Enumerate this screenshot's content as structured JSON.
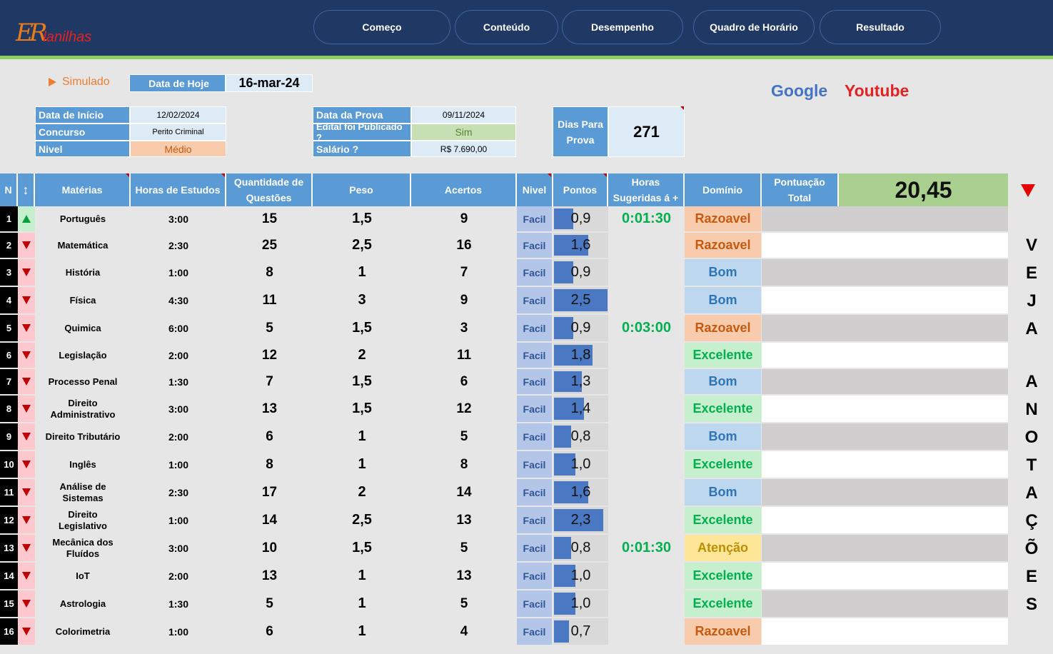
{
  "logo": {
    "mark": "ER",
    "text": "lanilhas"
  },
  "nav": [
    {
      "label": "Começo",
      "active": true
    },
    {
      "label": "Conteúdo",
      "active": false
    },
    {
      "label": "Desempenho",
      "active": false
    },
    {
      "label": "Quadro de Horário",
      "active": false
    },
    {
      "label": "Resultado",
      "active": false
    }
  ],
  "simulado": "Simulado",
  "data_hoje": {
    "label": "Data de Hoje",
    "value": "16-mar-24"
  },
  "info_left": [
    {
      "label": "Data  de Início",
      "value": "12/02/2024"
    },
    {
      "label": "Concurso",
      "value": "Perito Criminal"
    },
    {
      "label": "Nivel",
      "value": "Médio"
    }
  ],
  "info_mid": [
    {
      "label": "Data da Prova",
      "value": "09/11/2024"
    },
    {
      "label": "Edital foi Publicado ?",
      "value": "Sim"
    },
    {
      "label": "Salário ?",
      "value": "R$ 7.690,00"
    }
  ],
  "dias": {
    "label": "Dias Para Prova",
    "value": "271"
  },
  "links": {
    "google": "Google",
    "youtube": "Youtube"
  },
  "colors": {
    "header": "#1f3864",
    "accent_green": "#70ad47",
    "table_header": "#5b9bd5",
    "red": "#e52222",
    "blue_link": "#4472c4"
  },
  "table": {
    "headers": [
      "N",
      "↕",
      "Matérias",
      "Horas de Estudos",
      "Quantidade de Questões",
      "Peso",
      "Acertos",
      "Nivel",
      "Pontos",
      "Horas Sugeridas á +",
      "Domínio",
      "Pontuação Total"
    ],
    "total": "20,45",
    "max_pontos": 2.5,
    "rows": [
      {
        "n": "1",
        "trend": "up",
        "materia": "Português",
        "horas": "3:00",
        "qtd": "15",
        "peso": "1,5",
        "acertos": "9",
        "nivel": "Facil",
        "pontos": "0,9",
        "p": 0.9,
        "sugeridas": "0:01:30",
        "dominio": "Razoavel"
      },
      {
        "n": "2",
        "trend": "down",
        "materia": "Matemática",
        "horas": "2:30",
        "qtd": "25",
        "peso": "2,5",
        "acertos": "16",
        "nivel": "Facil",
        "pontos": "1,6",
        "p": 1.6,
        "sugeridas": "",
        "dominio": "Razoavel"
      },
      {
        "n": "3",
        "trend": "down",
        "materia": "História",
        "horas": "1:00",
        "qtd": "8",
        "peso": "1",
        "acertos": "7",
        "nivel": "Facil",
        "pontos": "0,9",
        "p": 0.9,
        "sugeridas": "",
        "dominio": "Bom"
      },
      {
        "n": "4",
        "trend": "down",
        "materia": "Física",
        "horas": "4:30",
        "qtd": "11",
        "peso": "3",
        "acertos": "9",
        "nivel": "Facil",
        "pontos": "2,5",
        "p": 2.5,
        "sugeridas": "",
        "dominio": "Bom"
      },
      {
        "n": "5",
        "trend": "down",
        "materia": "Quimica",
        "horas": "6:00",
        "qtd": "5",
        "peso": "1,5",
        "acertos": "3",
        "nivel": "Facil",
        "pontos": "0,9",
        "p": 0.9,
        "sugeridas": "0:03:00",
        "dominio": "Razoavel"
      },
      {
        "n": "6",
        "trend": "down",
        "materia": "Legislação",
        "horas": "2:00",
        "qtd": "12",
        "peso": "2",
        "acertos": "11",
        "nivel": "Facil",
        "pontos": "1,8",
        "p": 1.8,
        "sugeridas": "",
        "dominio": "Excelente"
      },
      {
        "n": "7",
        "trend": "down",
        "materia": "Processo Penal",
        "horas": "1:30",
        "qtd": "7",
        "peso": "1,5",
        "acertos": "6",
        "nivel": "Facil",
        "pontos": "1,3",
        "p": 1.3,
        "sugeridas": "",
        "dominio": "Bom"
      },
      {
        "n": "8",
        "trend": "down",
        "materia": "Direito Administrativo",
        "horas": "3:00",
        "qtd": "13",
        "peso": "1,5",
        "acertos": "12",
        "nivel": "Facil",
        "pontos": "1,4",
        "p": 1.4,
        "sugeridas": "",
        "dominio": "Excelente"
      },
      {
        "n": "9",
        "trend": "down",
        "materia": "Direito Tributário",
        "horas": "2:00",
        "qtd": "6",
        "peso": "1",
        "acertos": "5",
        "nivel": "Facil",
        "pontos": "0,8",
        "p": 0.8,
        "sugeridas": "",
        "dominio": "Bom"
      },
      {
        "n": "10",
        "trend": "down",
        "materia": "Inglês",
        "horas": "1:00",
        "qtd": "8",
        "peso": "1",
        "acertos": "8",
        "nivel": "Facil",
        "pontos": "1,0",
        "p": 1.0,
        "sugeridas": "",
        "dominio": "Excelente"
      },
      {
        "n": "11",
        "trend": "down",
        "materia": "Análise de Sistemas",
        "horas": "2:30",
        "qtd": "17",
        "peso": "2",
        "acertos": "14",
        "nivel": "Facil",
        "pontos": "1,6",
        "p": 1.6,
        "sugeridas": "",
        "dominio": "Bom"
      },
      {
        "n": "12",
        "trend": "down",
        "materia": "Direito Legislativo",
        "horas": "1:00",
        "qtd": "14",
        "peso": "2,5",
        "acertos": "13",
        "nivel": "Facil",
        "pontos": "2,3",
        "p": 2.3,
        "sugeridas": "",
        "dominio": "Excelente"
      },
      {
        "n": "13",
        "trend": "down",
        "materia": "Mecânica dos Fluídos",
        "horas": "3:00",
        "qtd": "10",
        "peso": "1,5",
        "acertos": "5",
        "nivel": "Facil",
        "pontos": "0,8",
        "p": 0.8,
        "sugeridas": "0:01:30",
        "dominio": "Atenção"
      },
      {
        "n": "14",
        "trend": "down",
        "materia": "IoT",
        "horas": "2:00",
        "qtd": "13",
        "peso": "1",
        "acertos": "13",
        "nivel": "Facil",
        "pontos": "1,0",
        "p": 1.0,
        "sugeridas": "",
        "dominio": "Excelente"
      },
      {
        "n": "15",
        "trend": "down",
        "materia": "Astrologia",
        "horas": "1:30",
        "qtd": "5",
        "peso": "1",
        "acertos": "5",
        "nivel": "Facil",
        "pontos": "1,0",
        "p": 1.0,
        "sugeridas": "",
        "dominio": "Excelente"
      },
      {
        "n": "16",
        "trend": "down",
        "materia": "Colorimetria",
        "horas": "1:00",
        "qtd": "6",
        "peso": "1",
        "acertos": "4",
        "nivel": "Facil",
        "pontos": "0,7",
        "p": 0.7,
        "sugeridas": "",
        "dominio": "Razoavel"
      }
    ]
  },
  "side_text": [
    "V",
    "E",
    "J",
    "A",
    "A",
    "N",
    "O",
    "T",
    "A",
    "Ç",
    "Õ",
    "E",
    "S"
  ]
}
